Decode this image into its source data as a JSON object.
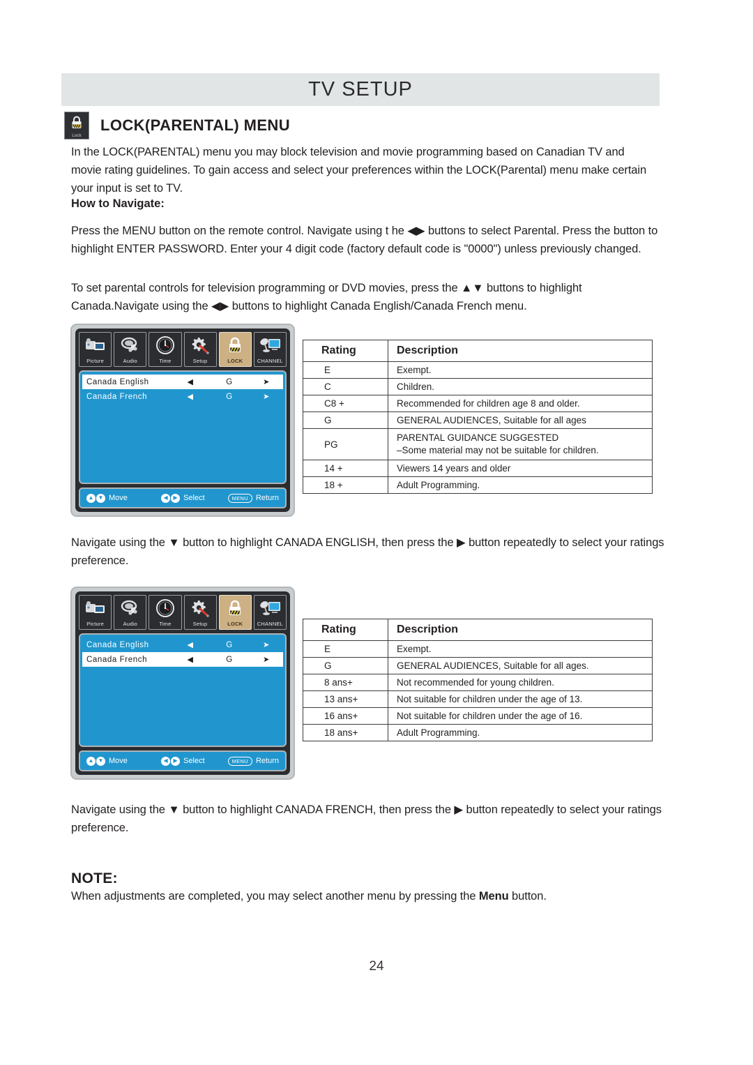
{
  "header": {
    "title": "TV SETUP",
    "section_heading": "LOCK(PARENTAL) MENU",
    "lock_chip_label": "Lock"
  },
  "body": {
    "intro": "In the LOCK(PARENTAL) menu you may block television and movie programming based on Canadian TV and movie rating guidelines. To gain access and select your preferences within the LOCK(Parental) menu make certain your input is set to TV.",
    "how_to_navigate_label": "How to Navigate:",
    "navigate_paragraph": "Press the MENU button on the remote control. Navigate using t he ◀▶ buttons to select Parental. Press the button to highlight ENTER PASSWORD. Enter your 4 digit code (factory default code is \"0000\") unless previously changed.",
    "set_controls_paragraph": "To set parental controls for television programming or DVD movies, press the ▲▼ buttons to highlight Canada.Navigate using the ◀▶ buttons to highlight Canada English/Canada French menu.",
    "english_instruction": "Navigate using the ▼ button to highlight CANADA ENGLISH, then press the ▶ button repeatedly to select your ratings preference.",
    "french_instruction": "Navigate using the ▼ button to highlight CANADA FRENCH, then press the ▶ button repeatedly to select your ratings preference.",
    "note_title": "NOTE:",
    "note_text_before": "When adjustments are completed, you may select another menu by pressing the ",
    "note_bold": "Menu",
    "note_text_after": " button."
  },
  "osd": {
    "icons": [
      {
        "name": "picture-icon",
        "label": "Picture",
        "active": false
      },
      {
        "name": "audio-icon",
        "label": "Audio",
        "active": false
      },
      {
        "name": "time-icon",
        "label": "Time",
        "active": false
      },
      {
        "name": "setup-icon",
        "label": "Setup",
        "active": false
      },
      {
        "name": "lock-icon",
        "label": "LOCK",
        "active": true
      },
      {
        "name": "channel-icon",
        "label": "CHANNEL",
        "active": false
      }
    ],
    "hints": {
      "move": "Move",
      "select": "Select",
      "return": "Return",
      "menu_key": "MENU"
    },
    "menu_one": {
      "rows": [
        {
          "label": "Canada English",
          "left_arrow": "◀",
          "value": "G",
          "right_arrow": "➤",
          "selected": true
        },
        {
          "label": "Canada French",
          "left_arrow": "◀",
          "value": "G",
          "right_arrow": "➤",
          "selected": false
        }
      ]
    },
    "menu_two": {
      "rows": [
        {
          "label": "Canada English",
          "left_arrow": "◀",
          "value": "G",
          "right_arrow": "➤",
          "selected": false
        },
        {
          "label": "Canada French",
          "left_arrow": "◀",
          "value": "G",
          "right_arrow": "➤",
          "selected": true
        }
      ]
    }
  },
  "tables": {
    "english": {
      "columns": [
        "Rating",
        "Description"
      ],
      "rows": [
        {
          "rating": "E",
          "description": "Exempt."
        },
        {
          "rating": "C",
          "description": "Children."
        },
        {
          "rating": "C8 +",
          "description": "Recommended  for  children  age  8  and  older."
        },
        {
          "rating": "G",
          "description": "GENERAL AUDIENCES, Suitable for all ages"
        },
        {
          "rating": "PG",
          "description": "PARENTAL GUIDANCE SUGGESTED",
          "description2": "–Some material may not be suitable for children."
        },
        {
          "rating": "14 +",
          "description": "Viewers 14 years and older"
        },
        {
          "rating": "18 +",
          "description": "Adult Programming."
        }
      ]
    },
    "french": {
      "columns": [
        "Rating",
        "Description"
      ],
      "rows": [
        {
          "rating": "E",
          "description": "Exempt."
        },
        {
          "rating": "G",
          "description": "GENERAL AUDIENCES, Suitable for all ages."
        },
        {
          "rating": "8 ans+",
          "description": "Not  recommended  for  young  children."
        },
        {
          "rating": "13 ans+",
          "description": "Not suitable for children under the age of 13."
        },
        {
          "rating": "16 ans+",
          "description": "Not suitable for children under the age of 16."
        },
        {
          "rating": "18 ans+",
          "description": "Adult Programming."
        }
      ]
    }
  },
  "footer": {
    "page_number": "24"
  },
  "colors": {
    "title_bar": "#e2e5e6",
    "osd_blue": "#2196ce",
    "osd_active": "#cdb083",
    "osd_frame": "#2a2c2f"
  }
}
